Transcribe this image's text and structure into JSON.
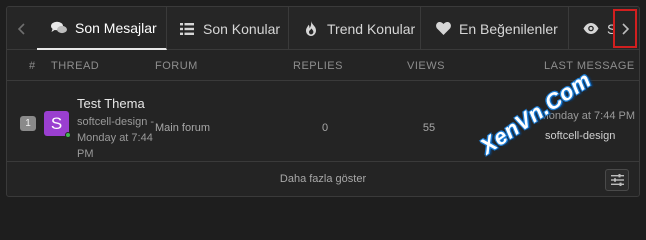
{
  "tabs": [
    {
      "label": "Son Mesajlar",
      "icon": "chat-bubbles-icon",
      "active": true
    },
    {
      "label": "Son Konular",
      "icon": "list-icon"
    },
    {
      "label": "Trend Konular",
      "icon": "flame-icon"
    },
    {
      "label": "En Beğenilenler",
      "icon": "heart-icon"
    },
    {
      "label": "So",
      "icon": "eye-icon"
    }
  ],
  "table": {
    "headers": {
      "rank": "#",
      "thread": "THREAD",
      "forum": "FORUM",
      "replies": "REPLIES",
      "views": "VIEWS",
      "last": "LAST MESSAGE"
    },
    "rows": [
      {
        "rank": "1",
        "avatar_letter": "S",
        "avatar_color": "#9a3fd0",
        "title": "Test Thema",
        "author_line": "softcell-design - Monday at 7:44 PM",
        "forum": "Main forum",
        "replies": "0",
        "views": "55",
        "last_time": "Monday at 7:44 PM",
        "last_user": "softcell-design"
      }
    ]
  },
  "footer": {
    "more_label": "Daha fazla göster"
  },
  "watermark": "XenVn.Com",
  "colors": {
    "highlight_border": "#d21f1f",
    "online": "#3fb950"
  }
}
